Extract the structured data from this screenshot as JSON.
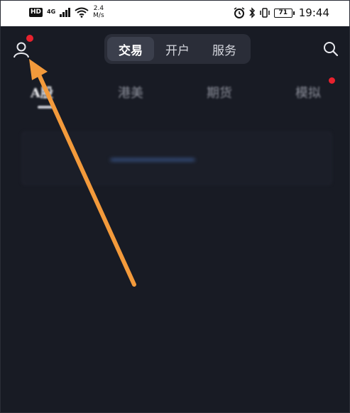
{
  "status_bar": {
    "hd_label": "HD",
    "network_type": "4G",
    "net_speed_value": "2.4",
    "net_speed_unit": "M/s",
    "battery_level": "71",
    "time": "19:44"
  },
  "top_nav": {
    "segments": [
      {
        "label": "交易",
        "active": true
      },
      {
        "label": "开户",
        "active": false
      },
      {
        "label": "服务",
        "active": false
      }
    ],
    "user_icon": "user-icon",
    "search_icon": "search-icon"
  },
  "market_tabs": [
    {
      "label": "A股",
      "active": true
    },
    {
      "label": "港美",
      "active": false
    },
    {
      "label": "期货",
      "active": false
    },
    {
      "label": "模拟",
      "active": false
    }
  ],
  "colors": {
    "background": "#181b24",
    "notification_dot": "#e8222e",
    "annotation_arrow": "#f39a3b",
    "segment_active_bg": "#3b3f4c"
  }
}
